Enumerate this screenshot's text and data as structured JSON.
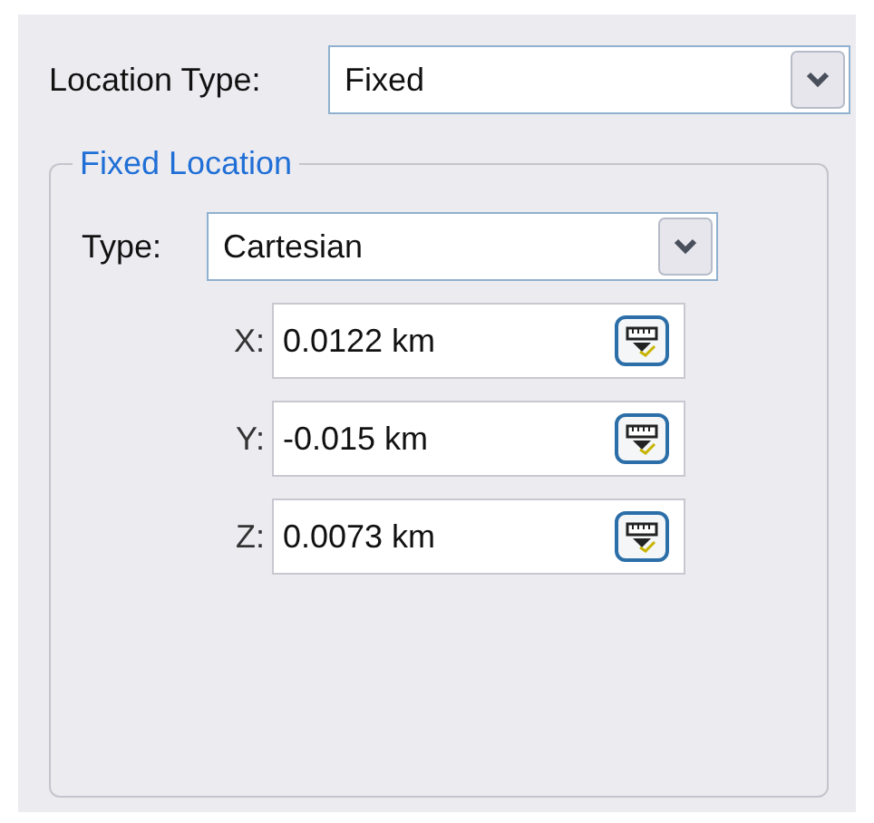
{
  "location_type": {
    "label": "Location Type:",
    "value": "Fixed"
  },
  "group": {
    "title": "Fixed Location",
    "type": {
      "label": "Type:",
      "value": "Cartesian"
    },
    "coordinates": [
      {
        "label": "X:",
        "value": "0.0122 km"
      },
      {
        "label": "Y:",
        "value": "-0.015 km"
      },
      {
        "label": "Z:",
        "value": "0.0073 km"
      }
    ]
  }
}
